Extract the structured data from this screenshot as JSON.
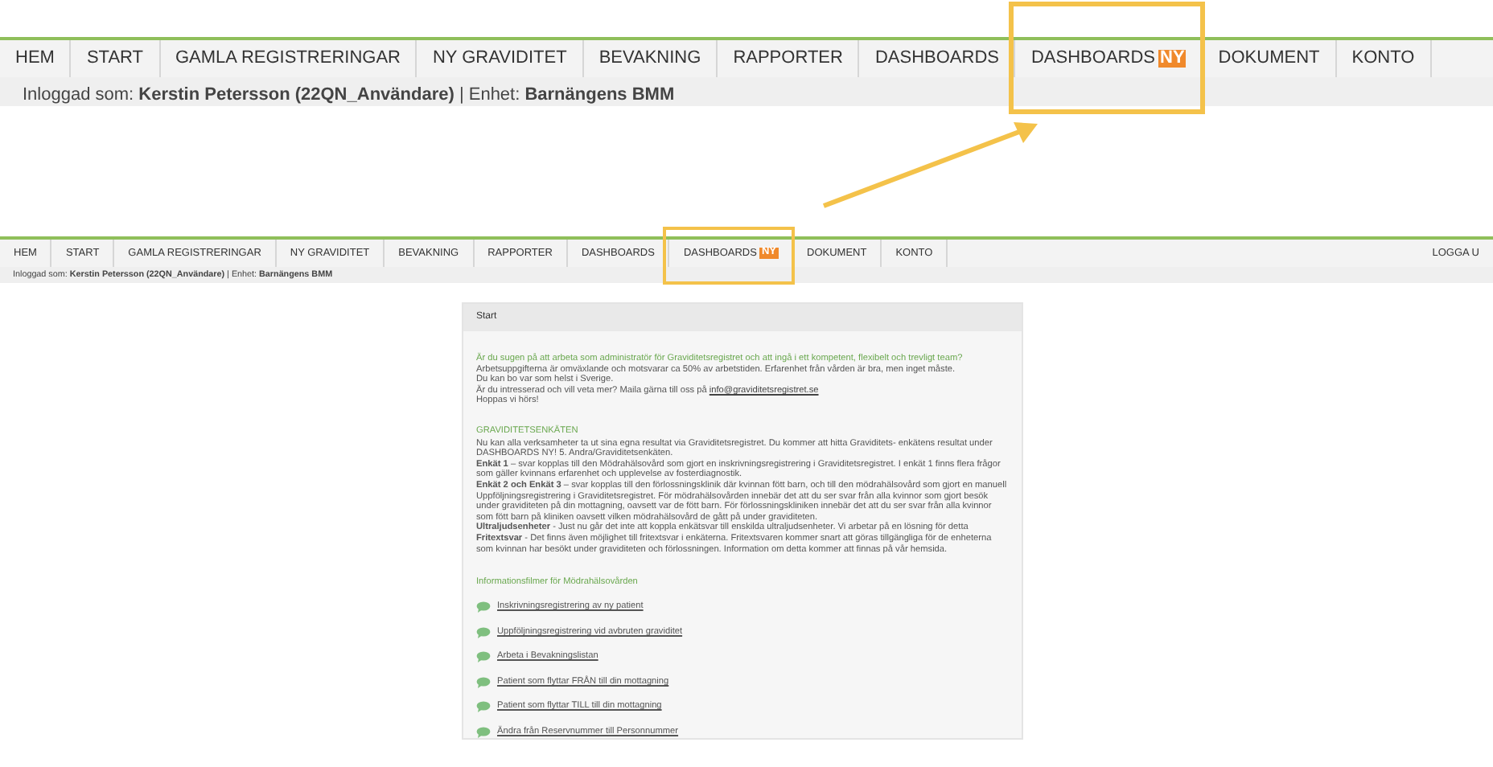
{
  "zoomed_view": {
    "nav_items": [
      {
        "label": "HEM",
        "highlighted": false
      },
      {
        "label": "START",
        "highlighted": false
      },
      {
        "label": "GAMLA REGISTRERINGAR",
        "highlighted": false
      },
      {
        "label": "NY GRAVIDITET",
        "highlighted": false
      },
      {
        "label": "BEVAKNING",
        "highlighted": false
      },
      {
        "label": "RAPPORTER",
        "highlighted": false
      },
      {
        "label": "DASHBOARDS",
        "highlighted": false
      },
      {
        "label": "DASHBOARDS",
        "badge": "NY",
        "highlighted": true
      },
      {
        "label": "DOKUMENT",
        "highlighted": false
      },
      {
        "label": "KONTO",
        "highlighted": false
      }
    ],
    "login_line": "Inloggad som: **Kerstin Petersson (22QN_Användare)** | Enhet: **Barnängens BMM**"
  },
  "page": {
    "nav_items": [
      {
        "label": "HEM",
        "highlighted": false
      },
      {
        "label": "START",
        "highlighted": false
      },
      {
        "label": "GAMLA REGISTRERINGAR",
        "highlighted": false
      },
      {
        "label": "NY GRAVIDITET",
        "highlighted": false
      },
      {
        "label": "BEVAKNING",
        "highlighted": false
      },
      {
        "label": "RAPPORTER",
        "highlighted": false
      },
      {
        "label": "DASHBOARDS",
        "highlighted": false
      },
      {
        "label": "DASHBOARDS",
        "badge": "NY",
        "highlighted": true
      },
      {
        "label": "DOKUMENT",
        "highlighted": false
      },
      {
        "label": "KONTO",
        "highlighted": false
      }
    ],
    "logout": "LOGGA U",
    "login_line": "Inloggad som: **Kerstin Petersson (22QN_Användare)** | Enhet: **Barnängens BMM**",
    "panel": {
      "title": "Start",
      "intro": [
        {
          "kind": "lead",
          "text": "Är du sugen på att arbeta som administratör för Graviditetsregistret och att ingå i ett kompetent, flexibelt och trevligt team?"
        },
        {
          "kind": "plain",
          "text": "Arbetsuppgifterna är omväxlande och motsvarar ca 50% av arbetstiden. Erfarenhet från vården är bra, men inget måste."
        },
        {
          "kind": "plain",
          "text": "Du kan bo var som helst i Sverige."
        },
        {
          "kind": "plain",
          "text": "Är du intresserad och vill veta mer? Maila gärna till oss på",
          "link": "info@graviditetsregistret.se"
        },
        {
          "kind": "plain",
          "text": "Hoppas vi hörs!"
        }
      ],
      "survey": {
        "heading": "GRAVIDITETSENKÄTEN",
        "paragraphs": [
          "Nu kan alla verksamheter ta ut sina egna resultat via Graviditetsregistret. Du kommer att hitta Graviditets- enkätens resultat under DASHBOARDS NY! 5. Andra/Graviditetsenkäten.",
          "**Enkät 1** – svar kopplas till den Mödrahälsovård som gjort en inskrivningsregistrering i Graviditetsregistret. I enkät 1 finns flera frågor som gäller kvinnans erfarenhet och upplevelse av fosterdiagnostik.",
          "**Enkät 2 och Enkät 3** – svar kopplas till den förlossningsklinik där kvinnan fött barn, och till den mödrahälsovård som gjort en manuell Uppföljningsregistrering i Graviditetsregistret. För mödrahälsovården innebär det att du ser svar från alla kvinnor som gjort besök under graviditeten på din mottagning, oavsett var de fött barn. För förlossningskliniken innebär det att du ser svar från alla kvinnor som fött barn på kliniken oavsett vilken mödrahälsovård de gått på under graviditeten.",
          "**Ultraljudsenheter** - Just nu går det inte att koppla enkätsvar till enskilda ultraljudsenheter. Vi arbetar på en lösning för detta",
          "**Fritextsvar** - Det finns även möjlighet till fritextsvar i enkäterna. Fritextsvaren kommer snart att göras tillgängliga för de enheterna som kvinnan har besökt under graviditeten och förlossningen. Information om detta kommer att finnas på vår hemsida."
        ]
      },
      "films": {
        "heading": "Informationsfilmer för Mödrahälsovården",
        "links": [
          "Inskrivningsregistrering av ny patient",
          "Uppföljningsregistrering vid avbruten graviditet",
          "Arbeta i Bevakningslistan",
          "Patient som flyttar FRÅN till din mottagning",
          "Patient som flyttar TILL till din mottagning",
          "Ändra från Reservnummer till Personnummer"
        ]
      }
    }
  }
}
